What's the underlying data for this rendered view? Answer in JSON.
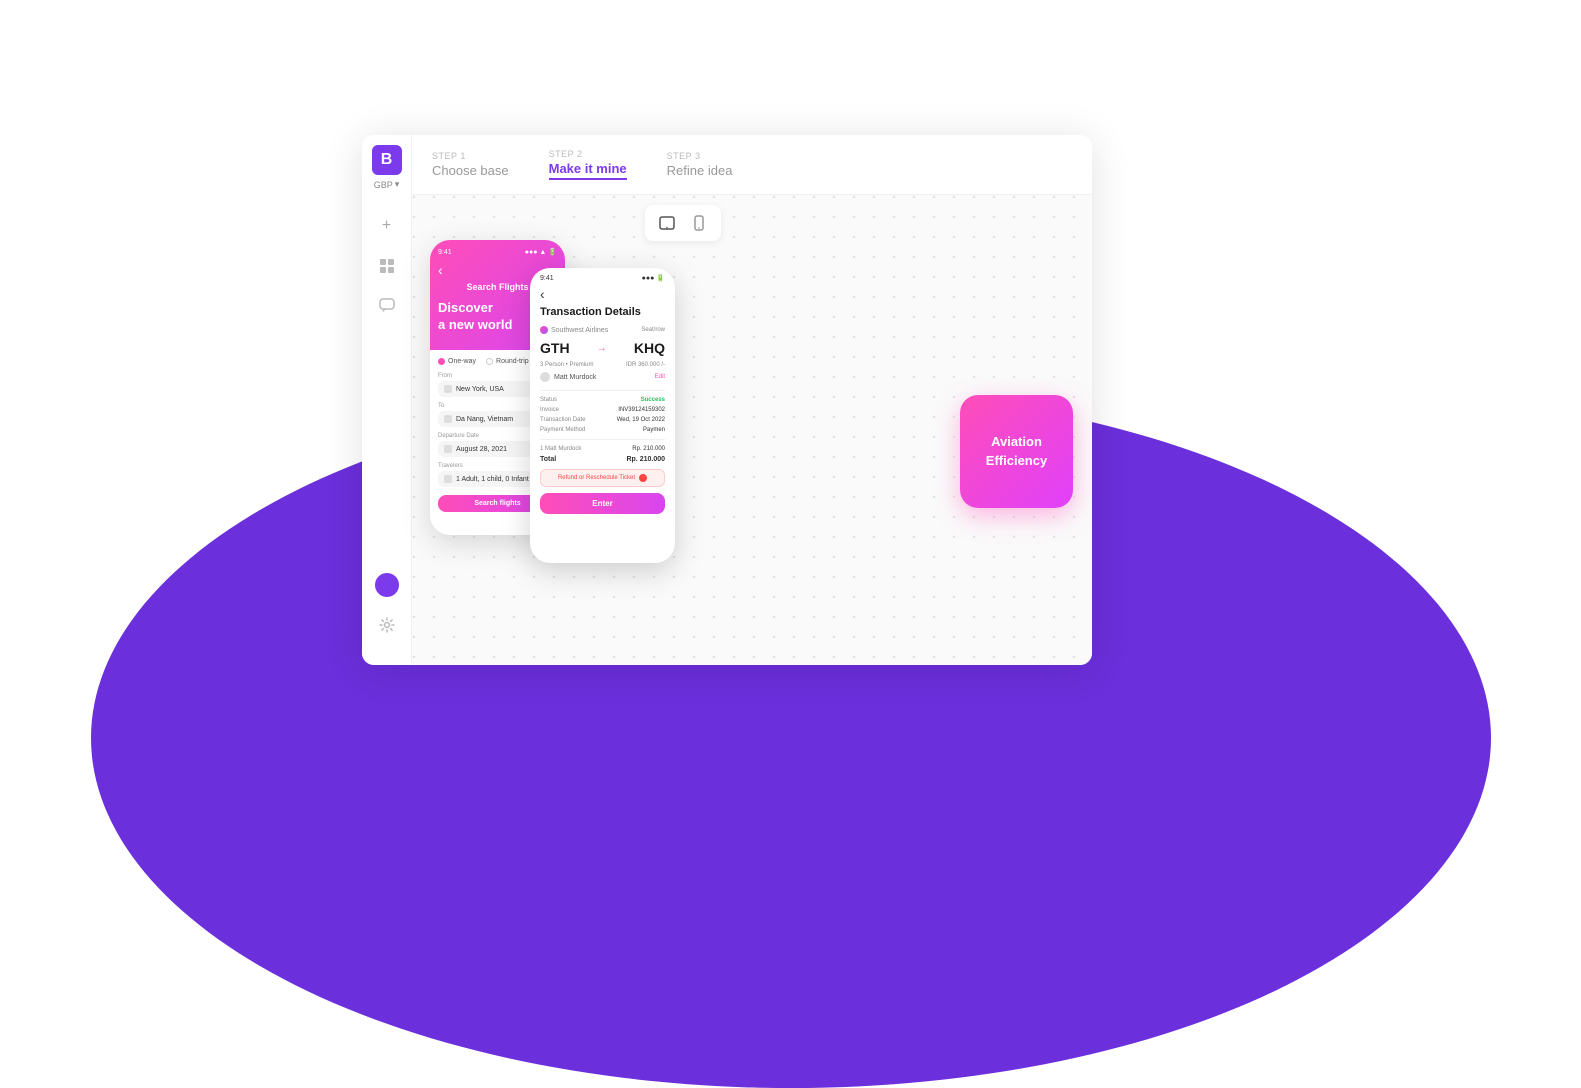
{
  "app": {
    "logo": "B",
    "currency": "GBP",
    "title": "Make it mine"
  },
  "sidebar": {
    "logo_letter": "B",
    "currency_label": "GBP",
    "currency_arrow": "▾",
    "add_icon": "+",
    "grid_icon": "⊞",
    "chat_icon": "💬"
  },
  "steps": [
    {
      "label": "STEP 1",
      "title": "Choose base",
      "active": false
    },
    {
      "label": "STEP 2",
      "title": "Make it mine",
      "active": true
    },
    {
      "label": "STEP 3",
      "title": "Refine idea",
      "active": false
    }
  ],
  "phone1": {
    "time": "9:41",
    "title": "Search Flights",
    "headline_line1": "Discover",
    "headline_line2": "a new world",
    "trip_one_way": "One-way",
    "trip_round": "Round-trip",
    "from_label": "From",
    "from_value": "New York, USA",
    "to_label": "To",
    "to_value": "Da Nang, Vietnam",
    "departure_label": "Departure Date",
    "departure_value": "August 28, 2021",
    "travelers_label": "Travelers",
    "travelers_value": "1 Adult, 1 child, 0 Infant",
    "search_btn": "Search flights"
  },
  "phone2": {
    "time": "9:41",
    "title": "Transaction Details",
    "airline_name": "Southwest Airlines",
    "seat_info": "Seat/row",
    "from_code": "GTH",
    "to_code": "KHQ",
    "passenger_count": "3 Person • Premium",
    "price": "IDR 360.000 /-",
    "passenger_name": "Matt Murdock",
    "edit": "Edit",
    "status_label": "Status",
    "status_value": "Success",
    "invoice_label": "Invoice",
    "invoice_value": "INV39124159302",
    "date_label": "Transaction Date",
    "date_value": "Wed, 19 Oct 2022",
    "payment_label": "Payment Method",
    "payment_value": "Paymen",
    "ticket_label": "1 Matt Murdock",
    "ticket_price": "Rp. 210.000",
    "total_label": "Total",
    "total_value": "Rp. 210.000",
    "refund_btn": "Refund or Reschedule Ticket",
    "enter_btn": "Enter"
  },
  "aviation_card": {
    "line1": "Aviation",
    "line2": "Efficiency"
  },
  "colors": {
    "primary_purple": "#7c3aed",
    "pink": "#ff4db8",
    "bg_circle": "#6b2fdb",
    "white": "#ffffff"
  }
}
